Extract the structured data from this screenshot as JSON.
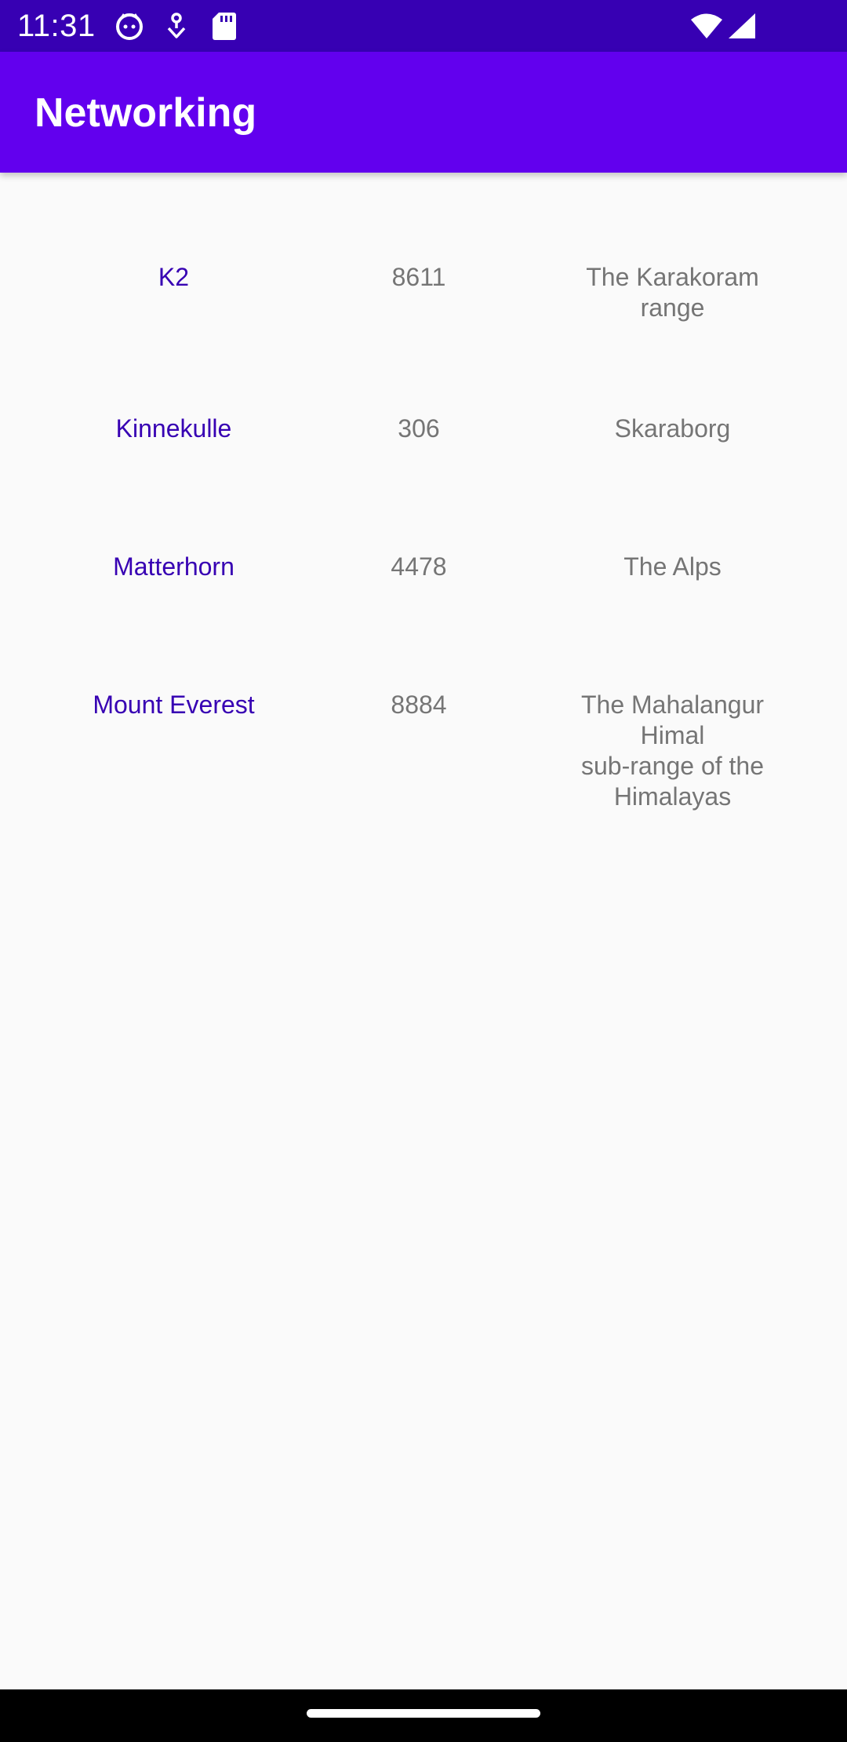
{
  "status_bar": {
    "time": "11:31",
    "icons": [
      "face-notification-icon",
      "download-notification-icon",
      "sd-card-icon",
      "wifi-icon",
      "signal-icon"
    ]
  },
  "app_bar": {
    "title": "Networking"
  },
  "colors": {
    "status_bar": "#3700b3",
    "app_bar": "#6200ee",
    "name_text": "#3700b3",
    "secondary_text": "#757575",
    "background": "#fafafa"
  },
  "mountains": [
    {
      "name": "K2",
      "height": "8611",
      "location": "The Karakoram\nrange"
    },
    {
      "name": "Kinnekulle",
      "height": "306",
      "location": "Skaraborg"
    },
    {
      "name": "Matterhorn",
      "height": "4478",
      "location": "The Alps"
    },
    {
      "name": "Mount Everest",
      "height": "8884",
      "location": "The Mahalangur\nHimal\nsub-range of the\nHimalayas"
    }
  ]
}
